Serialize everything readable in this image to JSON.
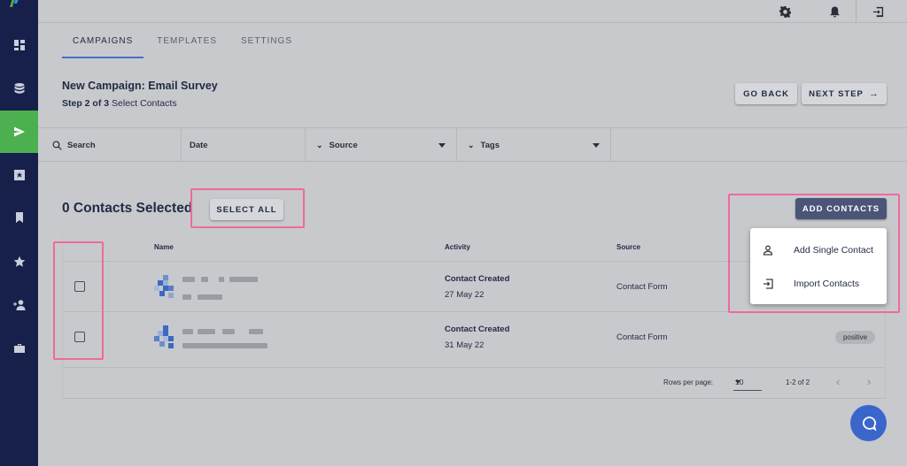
{
  "sidebar": {
    "items": [
      {
        "icon": "dashboard-icon"
      },
      {
        "icon": "database-icon"
      },
      {
        "icon": "send-icon",
        "active": true
      },
      {
        "icon": "asterisk-box-icon"
      },
      {
        "icon": "bookmark-icon"
      },
      {
        "icon": "star-icon"
      },
      {
        "icon": "person-add-icon"
      },
      {
        "icon": "briefcase-icon"
      }
    ]
  },
  "topbar": {
    "icons": [
      "gear-icon",
      "bell-icon",
      "logout-icon"
    ]
  },
  "tabs": [
    {
      "label": "CAMPAIGNS",
      "active": true
    },
    {
      "label": "TEMPLATES"
    },
    {
      "label": "SETTINGS"
    }
  ],
  "header": {
    "title": "New Campaign: Email Survey",
    "step": "Step 2 of 3",
    "step_desc": "Select Contacts",
    "go_back": "GO BACK",
    "next_step": "NEXT STEP"
  },
  "filters": {
    "search": "Search",
    "date": "Date",
    "source": "Source",
    "tags": "Tags"
  },
  "contacts": {
    "selected_label": "0 Contacts Selected",
    "select_all": "SELECT ALL",
    "add_contacts": "ADD CONTACTS",
    "columns": [
      "Name",
      "Activity",
      "Source"
    ],
    "rows": [
      {
        "activity": "Contact Created",
        "date": "27 May 22",
        "source": "Contact Form",
        "tag": ""
      },
      {
        "activity": "Contact Created",
        "date": "31 May 22",
        "source": "Contact Form",
        "tag": "positive"
      }
    ],
    "rows_per_page_label": "Rows per page:",
    "rows_per_page": "10",
    "range": "1-2 of 2"
  },
  "menu": {
    "items": [
      {
        "label": "Add Single Contact",
        "icon": "person-outline-icon"
      },
      {
        "label": "Import Contacts",
        "icon": "import-icon"
      }
    ]
  },
  "colors": {
    "sidebar": "#16204a",
    "active": "#4caf50",
    "primary_button": "#4a5578",
    "highlight": "#ef6a9c",
    "chat": "#3a66cc"
  }
}
